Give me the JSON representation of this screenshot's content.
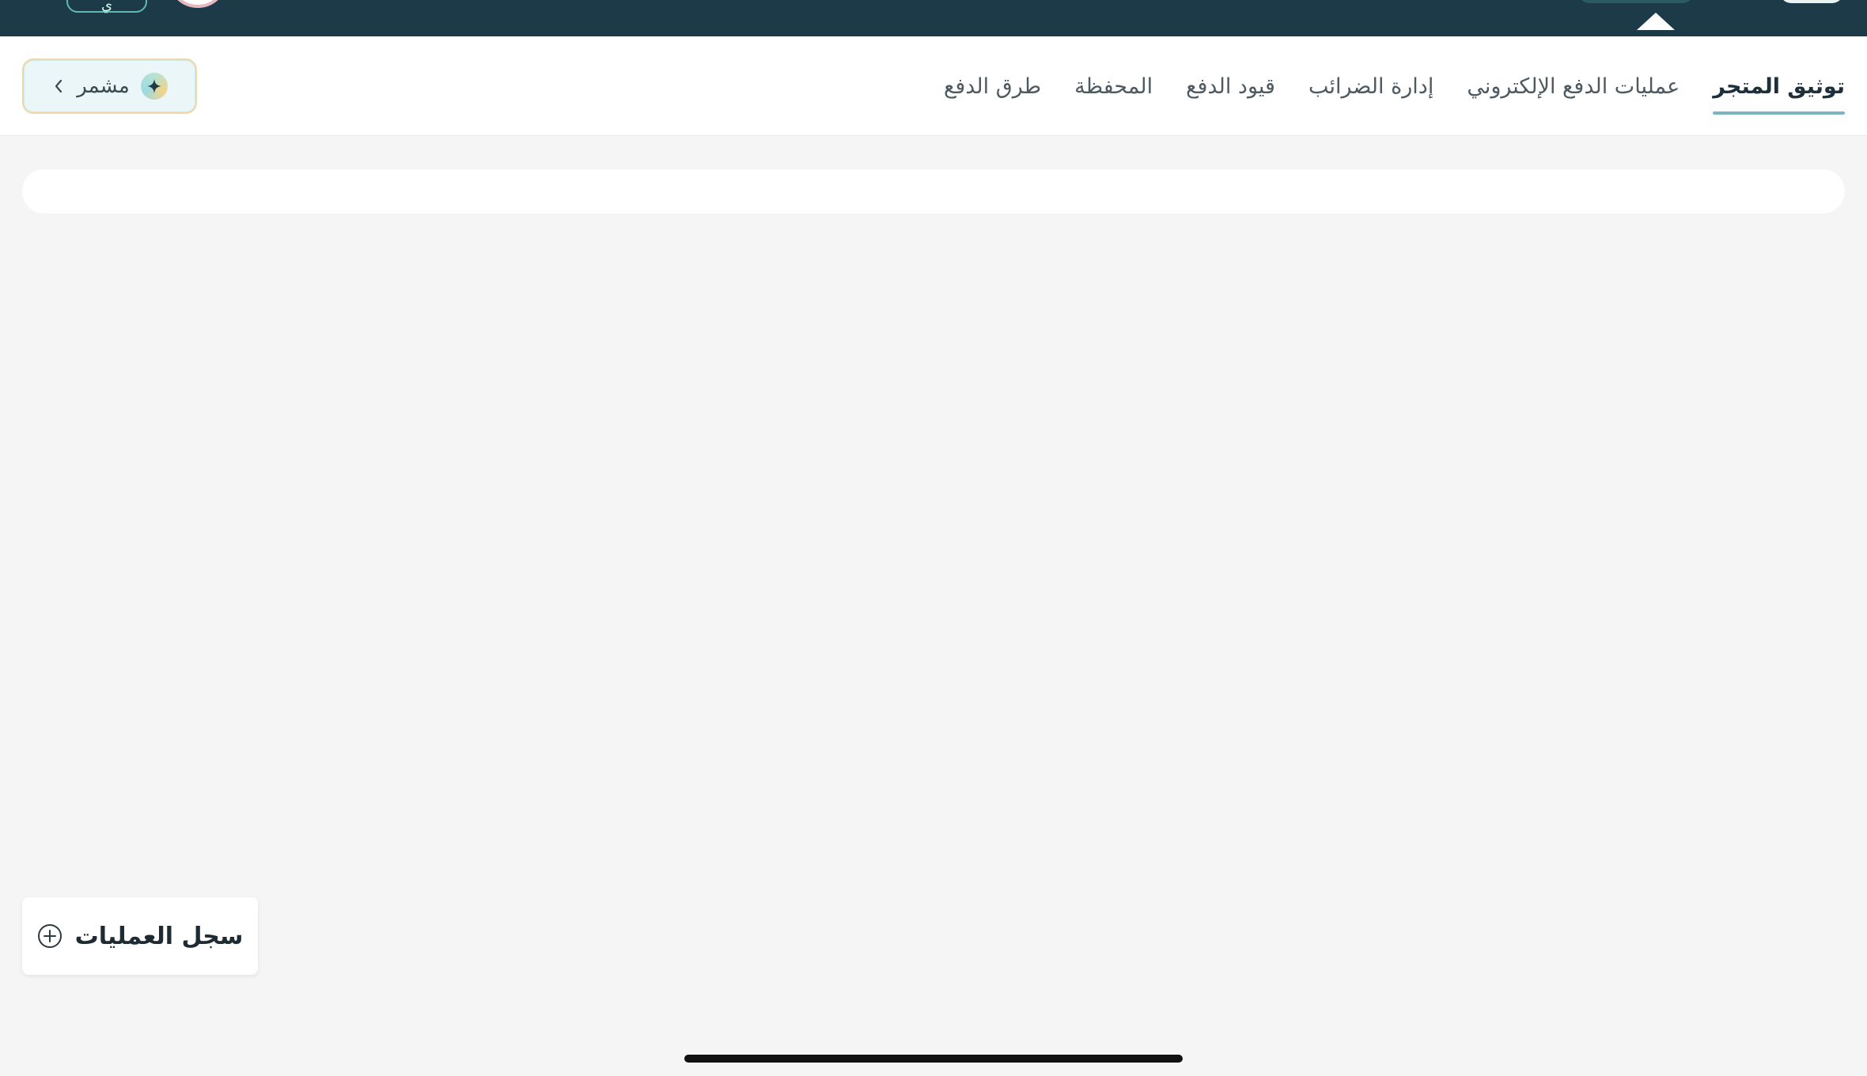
{
  "topbar": {
    "outline_button_label": "ي"
  },
  "tabs": [
    {
      "label": "طرق الدفع",
      "active": false
    },
    {
      "label": "المحفظة",
      "active": false
    },
    {
      "label": "قيود الدفع",
      "active": false
    },
    {
      "label": "إدارة الضرائب",
      "active": false
    },
    {
      "label": "عمليات الدفع الإلكتروني",
      "active": false
    },
    {
      "label": "توثيق المتجر",
      "active": true
    }
  ],
  "advisor": {
    "label": "مشمر",
    "icon": "sparkle-icon"
  },
  "ops_log": {
    "label": "سجل العمليات",
    "icon": "plus-circle-icon"
  },
  "colors": {
    "topbar": "#1d3a49",
    "active_underline": "#7bb4c3",
    "background": "#f5f5f5"
  }
}
